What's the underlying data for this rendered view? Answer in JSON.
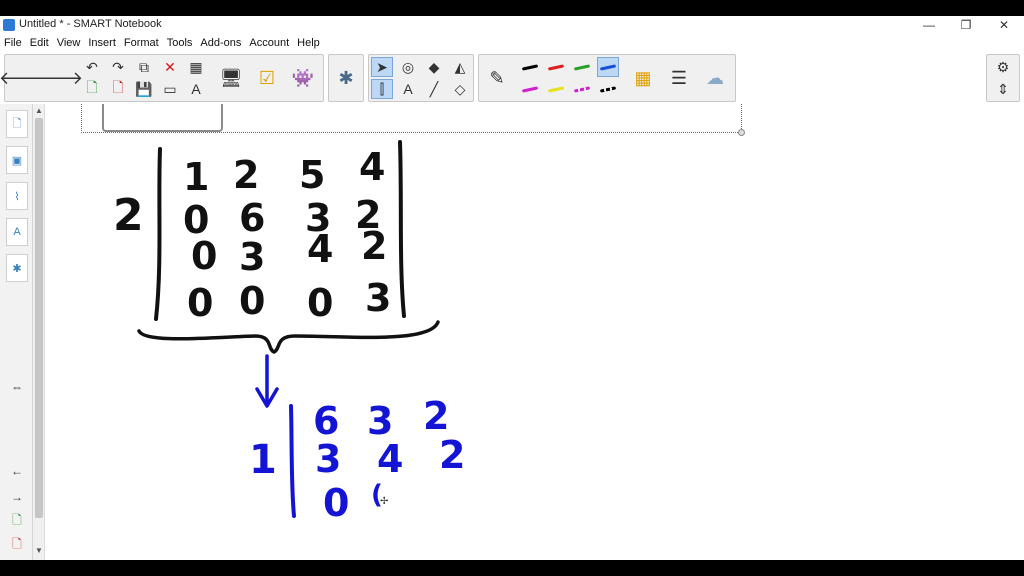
{
  "window": {
    "title": "Untitled * - SMART Notebook",
    "minimize": "—",
    "restore": "❐",
    "close": "✕"
  },
  "menu": [
    "File",
    "Edit",
    "View",
    "Insert",
    "Format",
    "Tools",
    "Add-ons",
    "Account",
    "Help"
  ],
  "toolbar": {
    "back_icon": "left-arrow-icon",
    "forward_icon": "right-arrow-icon",
    "pen_colors": [
      "#000000",
      "#e02020",
      "#2aa02a",
      "#1a4fd6",
      "#d020d0",
      "#e8e020",
      "#d020d0",
      "#000000"
    ],
    "selected_pen_color": "#1a4fd6"
  },
  "canvas": {
    "matrix_multiplier": "2",
    "matrix_rows": [
      [
        "1",
        "2",
        "5",
        "4"
      ],
      [
        "0",
        "6",
        "3",
        "2"
      ],
      [
        "0",
        "3",
        "4",
        "2"
      ],
      [
        "0",
        "0",
        "0",
        "3"
      ]
    ],
    "minor_multiplier": "1",
    "minor_rows": [
      [
        "6",
        "3",
        "2"
      ],
      [
        "3",
        "4",
        "2"
      ],
      [
        "0",
        "("
      ]
    ],
    "ink_color": "#111111",
    "blue_ink_color": "#1414d4"
  }
}
